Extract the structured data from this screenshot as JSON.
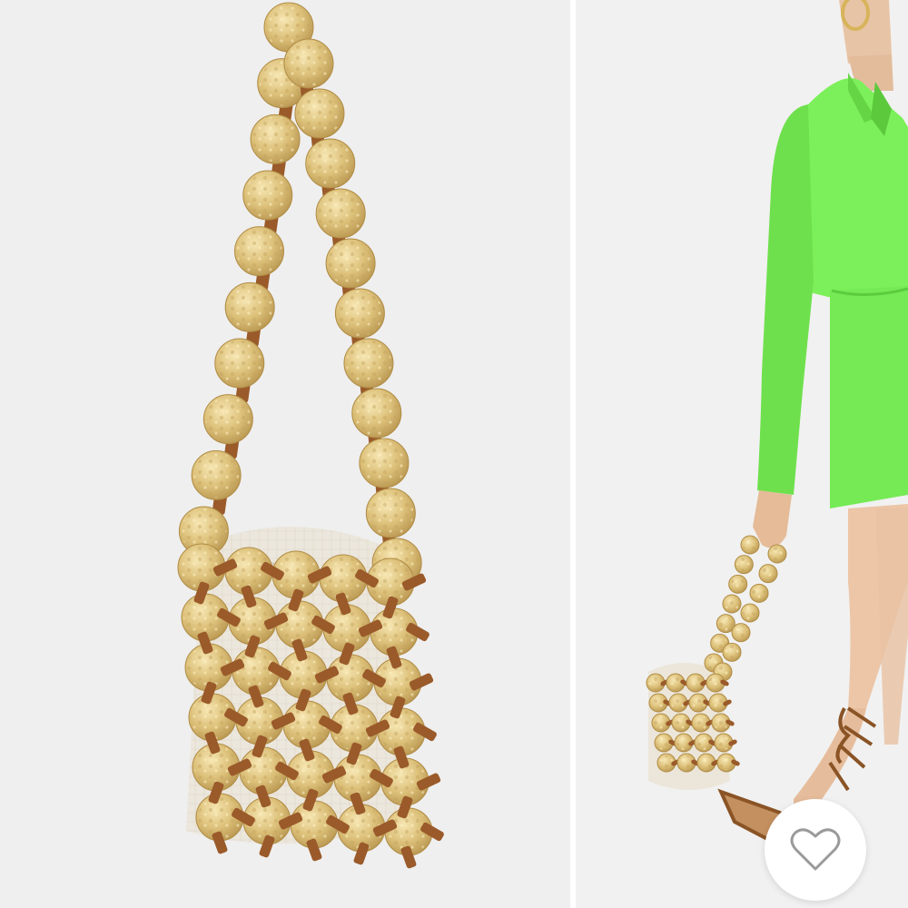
{
  "colors": {
    "background_left": "#efefef",
    "background_right": "#f1f1f1",
    "gold": "#d9bd72",
    "leather": "#9a5a2a",
    "canvas_lining": "#ebe6dc",
    "blazer": "#7cf05a",
    "skin": "#e8c4a6",
    "heart_outline": "#9a9a9a"
  },
  "left_image": {
    "subject": "bag-with-hammered-gold-disc-strap"
  },
  "right_image": {
    "subject": "model-in-green-blazer-holding-bag"
  },
  "favorite_button": {
    "icon": "heart-outline-icon",
    "state": "not-favorited"
  }
}
